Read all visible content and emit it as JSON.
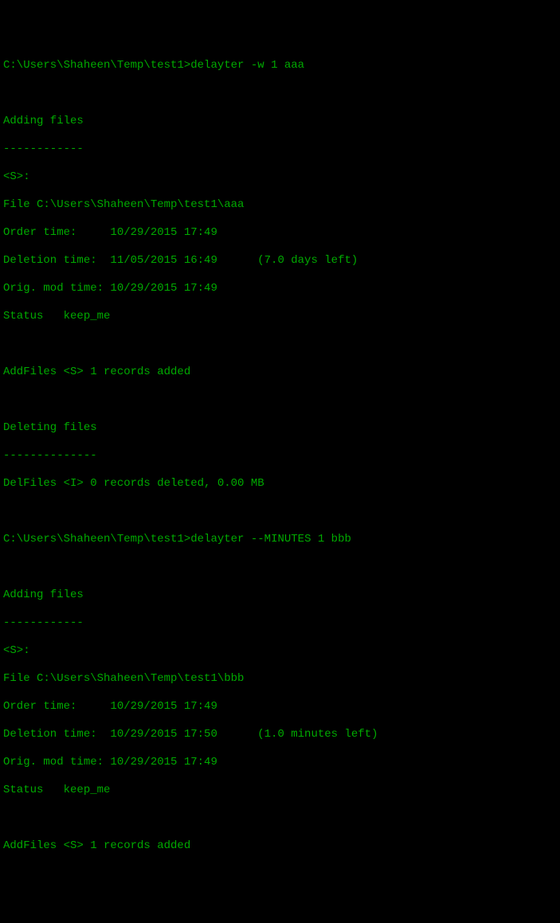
{
  "block1": {
    "prompt_prefix": "C:\\Users\\Shaheen\\Temp\\test1>",
    "command": "delayter -w 1 aaa",
    "heading": "Adding files",
    "divider": "------------",
    "tag": "<S>:",
    "file_label": "File ",
    "file_path": "C:\\Users\\Shaheen\\Temp\\test1\\aaa",
    "order_label": "Order time:     ",
    "order_value": "10/29/2015 17:49",
    "deletion_label": "Deletion time:  ",
    "deletion_value": "11/05/2015 16:49",
    "deletion_note": "      (7.0 days left)",
    "orig_label": "Orig. mod time: ",
    "orig_value": "10/29/2015 17:49",
    "status_label": "Status   ",
    "status_value": "keep_me",
    "addfiles": "AddFiles <S> 1 records added",
    "delheading": "Deleting files",
    "deldivider": "--------------",
    "delfiles": "DelFiles <I> 0 records deleted, 0.00 MB"
  },
  "block2": {
    "prompt_prefix": "C:\\Users\\Shaheen\\Temp\\test1>",
    "command": "delayter --MINUTES 1 bbb",
    "heading": "Adding files",
    "divider": "------------",
    "tag": "<S>:",
    "file_label": "File ",
    "file_path": "C:\\Users\\Shaheen\\Temp\\test1\\bbb",
    "order_label": "Order time:     ",
    "order_value": "10/29/2015 17:49",
    "deletion_label": "Deletion time:  ",
    "deletion_value": "10/29/2015 17:50",
    "deletion_note": "      (1.0 minutes left)",
    "orig_label": "Orig. mod time: ",
    "orig_value": "10/29/2015 17:49",
    "status_label": "Status   ",
    "status_value": "keep_me",
    "addfiles": "AddFiles <S> 1 records added"
  }
}
